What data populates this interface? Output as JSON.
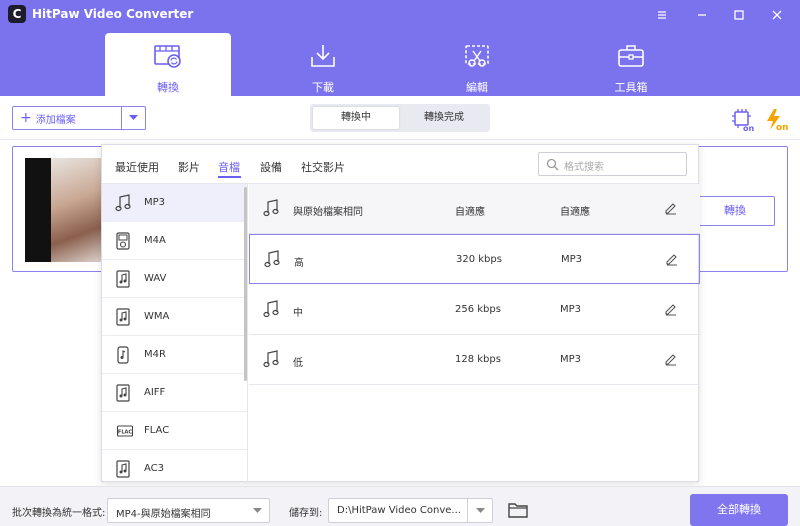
{
  "window": {
    "title": "HitPaw Video Converter",
    "logo_letter": "C"
  },
  "main_tabs": [
    {
      "label": "轉換",
      "icon": "film-convert-icon",
      "active": true
    },
    {
      "label": "下載",
      "icon": "download-tray-icon",
      "active": false
    },
    {
      "label": "編輯",
      "icon": "scissors-edit-icon",
      "active": false
    },
    {
      "label": "工具箱",
      "icon": "toolbox-icon",
      "active": false
    }
  ],
  "toolbar": {
    "add_label": "添加檔案",
    "segments": {
      "converting": "轉換中",
      "completed": "轉換完成"
    },
    "hw_accel_icon": "chip-on-icon",
    "turbo_icon": "lightning-on-icon"
  },
  "file_card": {
    "convert_label": "轉換"
  },
  "format_popup": {
    "categories": [
      "最近使用",
      "影片",
      "音檔",
      "設備",
      "社交影片"
    ],
    "active_category": "音檔",
    "search_placeholder": "格式搜索",
    "formats": [
      {
        "label": "MP3",
        "icon": "music-note-icon",
        "selected": true
      },
      {
        "label": "M4A",
        "icon": "ipod-icon",
        "selected": false
      },
      {
        "label": "WAV",
        "icon": "audio-file-icon",
        "selected": false
      },
      {
        "label": "WMA",
        "icon": "audio-file-icon",
        "selected": false
      },
      {
        "label": "M4R",
        "icon": "ringtone-icon",
        "selected": false
      },
      {
        "label": "AIFF",
        "icon": "audio-file-icon",
        "selected": false
      },
      {
        "label": "FLAC",
        "icon": "flac-icon",
        "selected": false
      },
      {
        "label": "AC3",
        "icon": "audio-file-icon",
        "selected": false
      }
    ],
    "qualities": [
      {
        "name": "與原始檔案相同",
        "rate": "自適應",
        "format": "自適應"
      },
      {
        "name": "高",
        "rate": "320 kbps",
        "format": "MP3"
      },
      {
        "name": "中",
        "rate": "256 kbps",
        "format": "MP3"
      },
      {
        "name": "低",
        "rate": "128 kbps",
        "format": "MP3"
      }
    ]
  },
  "footer": {
    "batch_label": "批次轉換為統一格式:",
    "batch_value": "MP4-與原始檔案相同",
    "save_label": "儲存到:",
    "save_path": "D:\\HitPaw Video Conve...",
    "convert_all": "全部轉換"
  },
  "colors": {
    "accent": "#7b72ee",
    "accent_text": "#6a5ff0",
    "turbo": "#f5a300"
  }
}
